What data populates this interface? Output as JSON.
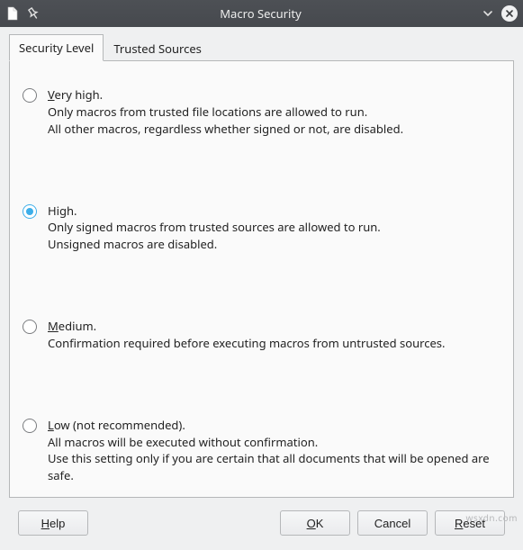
{
  "window": {
    "title": "Macro Security"
  },
  "tabs": {
    "security_level": "Security Level",
    "trusted_sources": "Trusted Sources"
  },
  "options": {
    "very_high": {
      "title_pre": "V",
      "title_post": "ery high.",
      "desc1": "Only macros from trusted file locations are allowed to run.",
      "desc2": "All other macros, regardless whether signed or not, are disabled."
    },
    "high": {
      "title": "High.",
      "desc1": "Only signed macros from trusted sources are allowed to run.",
      "desc2": "Unsigned macros are disabled."
    },
    "medium": {
      "title_pre": "M",
      "title_post": "edium.",
      "desc1": "Confirmation required before executing macros from untrusted sources."
    },
    "low": {
      "title_pre": "L",
      "title_post": "ow (not recommended).",
      "desc1": "All macros will be executed without confirmation.",
      "desc2": "Use this setting only if you are certain that all documents that will be opened are safe."
    }
  },
  "buttons": {
    "help_pre": "H",
    "help_post": "elp",
    "ok_pre": "O",
    "ok_post": "K",
    "cancel": "Cancel",
    "reset_pre": "R",
    "reset_post": "eset"
  },
  "watermark": "wsxdn.com"
}
